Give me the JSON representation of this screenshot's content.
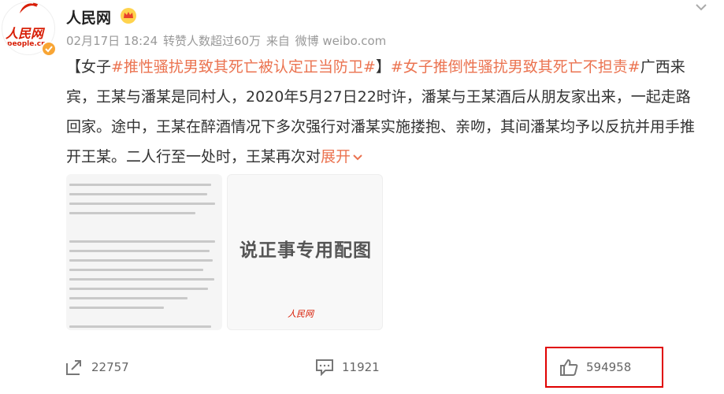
{
  "account": {
    "username": "人民网",
    "avatar_text": "人民网",
    "avatar_url_text": "people.cn",
    "more_icon": "chevron-down-icon"
  },
  "post": {
    "date": "02月17日 18:24",
    "reposts_info": "转赞人数超过60万",
    "source_prefix": "来自",
    "source": "微博 weibo.com",
    "bracket_open": "【女子",
    "tag1": "#推性骚扰男致其死亡被认定正当防卫#",
    "bracket_close": "】",
    "tag2": "#女子推倒性骚扰男致其死亡不担责#",
    "text": "广西来宾，王某与潘某是同村人，2020年5月27日22时许，潘某与王某酒后从朋友家出来，一起走路回家。途中，王某在醉酒情况下多次强行对潘某实施搂抱、亲吻，其间潘某均予以反抗并用手推开王某。二人行至一处时，王某再次对",
    "expand": "展开"
  },
  "images": {
    "second_caption": "说正事专用配图",
    "second_stamp": "人民网"
  },
  "actions": {
    "repost_count": "22757",
    "comment_count": "11921",
    "like_count": "594958"
  },
  "colors": {
    "accent": "#eb7350",
    "brand_red": "#d81e06",
    "highlight_box": "#e00000"
  }
}
